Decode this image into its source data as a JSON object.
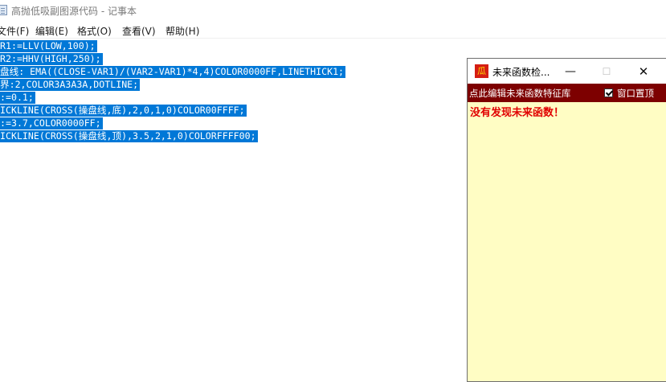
{
  "notepad": {
    "title": "高抛低吸副图源代码 - 记事本",
    "menu": [
      {
        "label": "文件(F)"
      },
      {
        "label": "编辑(E)"
      },
      {
        "label": "格式(O)"
      },
      {
        "label": "查看(V)"
      },
      {
        "label": "帮助(H)"
      }
    ],
    "lines": [
      "R1:=LLV(LOW,100);",
      "R2:=HHV(HIGH,250);",
      "盘线: EMA((CLOSE-VAR1)/(VAR2-VAR1)*4,4)COLOR0000FF,LINETHICK1;",
      "界:2,COLOR3A3A3A,DOTLINE;",
      ":=0.1;",
      "ICKLINE(CROSS(操盘线,底),2,0,1,0)COLOR00FFFF;",
      ":=3.7,COLOR0000FF;",
      "ICKLINE(CROSS(操盘线,顶),3.5,2,1,0)COLORFFFF00;"
    ]
  },
  "popup": {
    "title": "未来函数检...",
    "icon_glyph": "瓜",
    "edit_link": "点此编辑未来函数特征库",
    "topmost_label": "窗口置顶",
    "topmost_checked": true,
    "message": "没有发现未来函数！",
    "colors": {
      "toolbar": "#7d0000",
      "content": "#fffdc4",
      "message": "#e10000"
    }
  },
  "colors": {
    "selection": "#0078d7"
  }
}
